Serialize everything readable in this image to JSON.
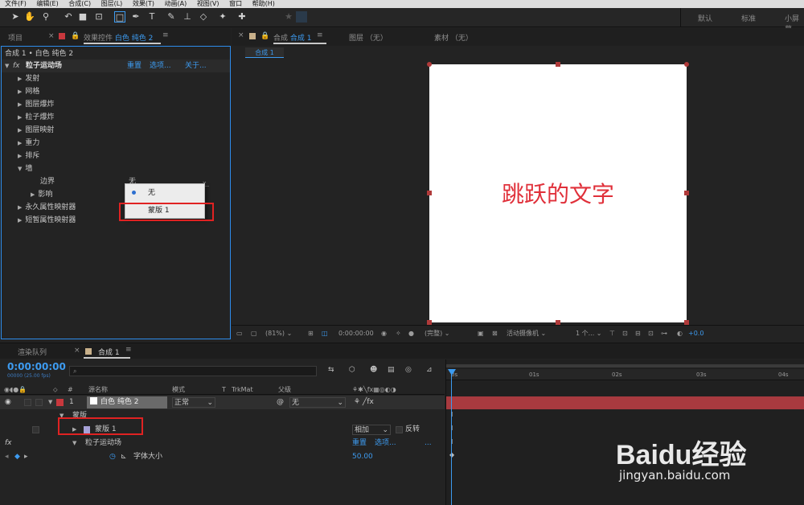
{
  "menu": [
    "文件(F)",
    "编辑(E)",
    "合成(C)",
    "图层(L)",
    "效果(T)",
    "动画(A)",
    "视图(V)",
    "窗口",
    "帮助(H)"
  ],
  "workspaces": [
    "默认",
    "标准",
    "小屏幕"
  ],
  "left_panel": {
    "tab_project": "项目",
    "tab_effects_prefix": "效果控件",
    "tab_effects_layer": "白色 纯色 2",
    "breadcrumb": "合成 1 • 白色 纯色 2",
    "effect_name": "粒子运动场",
    "fx_label": "fx",
    "reset": "重置",
    "options": "选项...",
    "about": "关于...",
    "groups": [
      "发射",
      "网格",
      "图层爆炸",
      "粒子爆炸",
      "图层映射",
      "重力",
      "排斥"
    ],
    "wall": "墙",
    "boundary": "边界",
    "boundary_value": "无",
    "influence": "影响",
    "persistent": "永久属性映射器",
    "ephemeral": "短暂属性映射器",
    "dropdown_options": [
      "无",
      "蒙版 1"
    ]
  },
  "viewer": {
    "tab_comp_prefix": "合成",
    "tab_comp_name": "合成 1",
    "tab_layer": "图层 （无）",
    "tab_footage": "素材 （无）",
    "subtab": "合成 1",
    "canvas_text": "跳跃的文字",
    "zoom": "(81%)",
    "timecode": "0:00:00:00",
    "resolution": "(完整)",
    "camera": "活动摄像机",
    "views": "1 个...",
    "exposure": "+0.0"
  },
  "timeline": {
    "tab_render": "渲染队列",
    "tab_comp": "合成 1",
    "timecode": "0:00:00:00",
    "frames": "00000 (25.00 fps)",
    "search_placeholder": "",
    "col_hash": "#",
    "col_source": "源名称",
    "col_mode": "模式",
    "col_t": "T",
    "col_trkmat": "TrkMat",
    "col_parent": "父级",
    "layer_num": "1",
    "layer_name": "白色 纯色 2",
    "layer_mode": "正常",
    "layer_parent": "无",
    "masks_group": "蒙版",
    "mask_name": "蒙版 1",
    "mask_mode": "相加",
    "mask_invert": "反转",
    "effect_name": "粒子运动场",
    "effect_reset": "重置",
    "effect_options": "选项...",
    "effect_more": "...",
    "prop_name": "字体大小",
    "prop_value": "50.00",
    "fx_label": "fx",
    "ruler": [
      "0s",
      "01s",
      "02s",
      "03s",
      "04s"
    ]
  },
  "watermark": {
    "brand": "Baidu经验",
    "url": "jingyan.baidu.com"
  },
  "colors": {
    "accent": "#2d8ceb",
    "layer_bar": "#a83a3f",
    "canvas_text": "#e0303a",
    "highlight_box": "#e02222"
  }
}
